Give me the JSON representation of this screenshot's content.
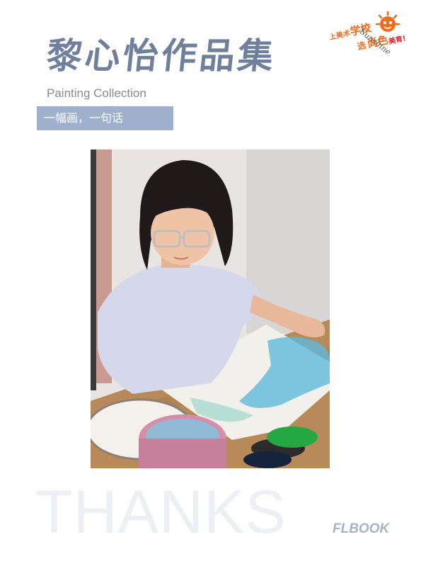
{
  "title": "黎心怡作品集",
  "subtitle": "Painting Collection",
  "tagline": "一幅画，一句话",
  "logo": {
    "line1": "上美术",
    "word1": "学校",
    "line2": "选",
    "word2": "尚色",
    "line3": "美育!",
    "script": "Sunshine",
    "colors": {
      "orange": "#f26a1b",
      "red": "#d9232d"
    }
  },
  "photo_alt": "girl-painting-watercolor",
  "thanks": "THANKS",
  "brand": "FLBOOK"
}
